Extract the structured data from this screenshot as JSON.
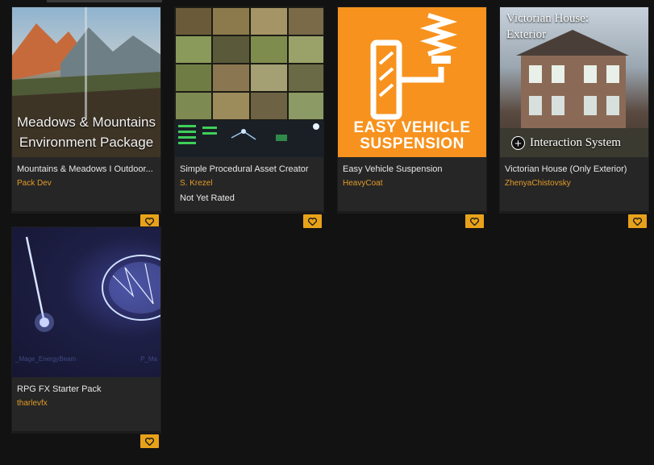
{
  "cards": [
    {
      "thumb_caption_lines": [
        "Meadows & Mountains",
        "Environment Package"
      ],
      "title": "Mountains & Meadows I Outdoor...",
      "author": "Pack Dev",
      "rating": ""
    },
    {
      "title": "Simple Procedural Asset Creator",
      "author": "S. Krezel",
      "rating": "Not Yet Rated"
    },
    {
      "thumb_caption_lines": [
        "EASY VEHICLE",
        "SUSPENSION"
      ],
      "title": "Easy Vehicle Suspension",
      "author": "HeavyCoat",
      "rating": ""
    },
    {
      "thumb_caption_lines": [
        "Victorian House:",
        "Exterior"
      ],
      "thumb_sub": "Interaction System",
      "title": "Victorian House (Only Exterior)",
      "author": "ZhenyaChistovsky",
      "rating": ""
    },
    {
      "thumb_labels": [
        "_Mage_EnergyBeam",
        "P_Ma"
      ],
      "title": "RPG FX Starter Pack",
      "author": "tharlevfx",
      "rating": ""
    }
  ],
  "icons": {
    "favorite": "heart-icon",
    "add": "plus-circle-icon"
  },
  "colors": {
    "background": "#121212",
    "card": "#262626",
    "author": "#e39b28",
    "favorite_button": "#e8a21a",
    "suspension_thumb": "#f7921e"
  }
}
